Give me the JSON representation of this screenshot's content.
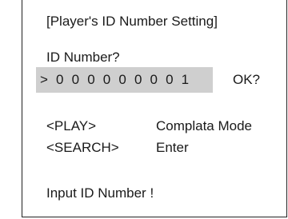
{
  "screen": {
    "title": "[Player's ID Number Setting]",
    "prompt": "ID Number?",
    "id_value": "> 0 0 0 0 0 0 0 0 1",
    "confirm": "OK?",
    "keys": [
      {
        "key": "<PLAY>",
        "action": "Complata Mode"
      },
      {
        "key": "<SEARCH>",
        "action": "Enter"
      }
    ],
    "message": "Input ID Number !"
  },
  "colors": {
    "highlight": "#cfcfcf",
    "border": "#222222",
    "text": "#1a1a1a"
  }
}
